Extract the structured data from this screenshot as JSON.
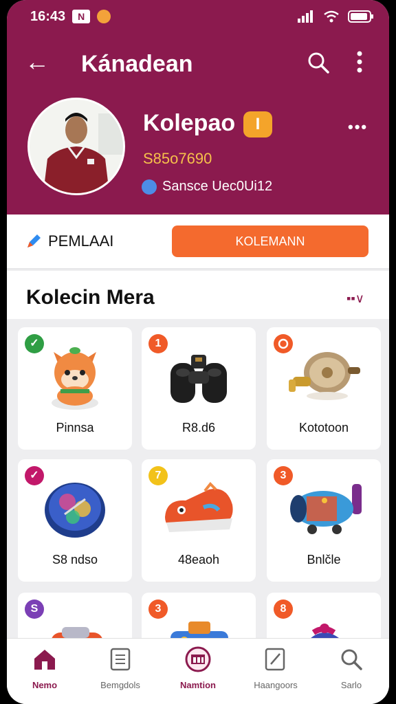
{
  "status": {
    "time": "16:43",
    "badge": "N"
  },
  "appbar": {
    "title": "Kánadean"
  },
  "profile": {
    "name": "Kolepao",
    "badge": "I",
    "number": "S85o7690",
    "subtitle": "Sansce Uec0Ui12"
  },
  "actions": {
    "left_label": "PEMLAAI",
    "button_label": "KOLEMANN"
  },
  "section": {
    "title": "Kolecin Mera"
  },
  "cards": [
    {
      "badge": "✓",
      "badge_color": "#2f9e44",
      "caption": "Pinnsa"
    },
    {
      "badge": "1",
      "badge_color": "#f05a28",
      "caption": "R8.d6"
    },
    {
      "badge": "",
      "badge_color": "#f05a28",
      "caption": "Kototoon"
    },
    {
      "badge": "✓",
      "badge_color": "#c2186a",
      "caption": "S8 ndso"
    },
    {
      "badge": "7",
      "badge_color": "#f2c21a",
      "caption": "48eaoh"
    },
    {
      "badge": "3",
      "badge_color": "#f05a28",
      "caption": "Bnlčle"
    },
    {
      "badge": "S",
      "badge_color": "#7b3fb5",
      "caption": ""
    },
    {
      "badge": "3",
      "badge_color": "#f05a28",
      "caption": ""
    },
    {
      "badge": "8",
      "badge_color": "#f05a28",
      "caption": ""
    }
  ],
  "nav": [
    {
      "label": "Nemo",
      "icon": "home-icon"
    },
    {
      "label": "Bemgdols",
      "icon": "document-icon"
    },
    {
      "label": "Namtion",
      "icon": "collection-icon"
    },
    {
      "label": "Haangoors",
      "icon": "edit-icon"
    },
    {
      "label": "Sarlo",
      "icon": "search-icon"
    }
  ],
  "colors": {
    "primary": "#8b1a4e",
    "accent": "#f46a2e",
    "badge_gold": "#f4a42a"
  }
}
